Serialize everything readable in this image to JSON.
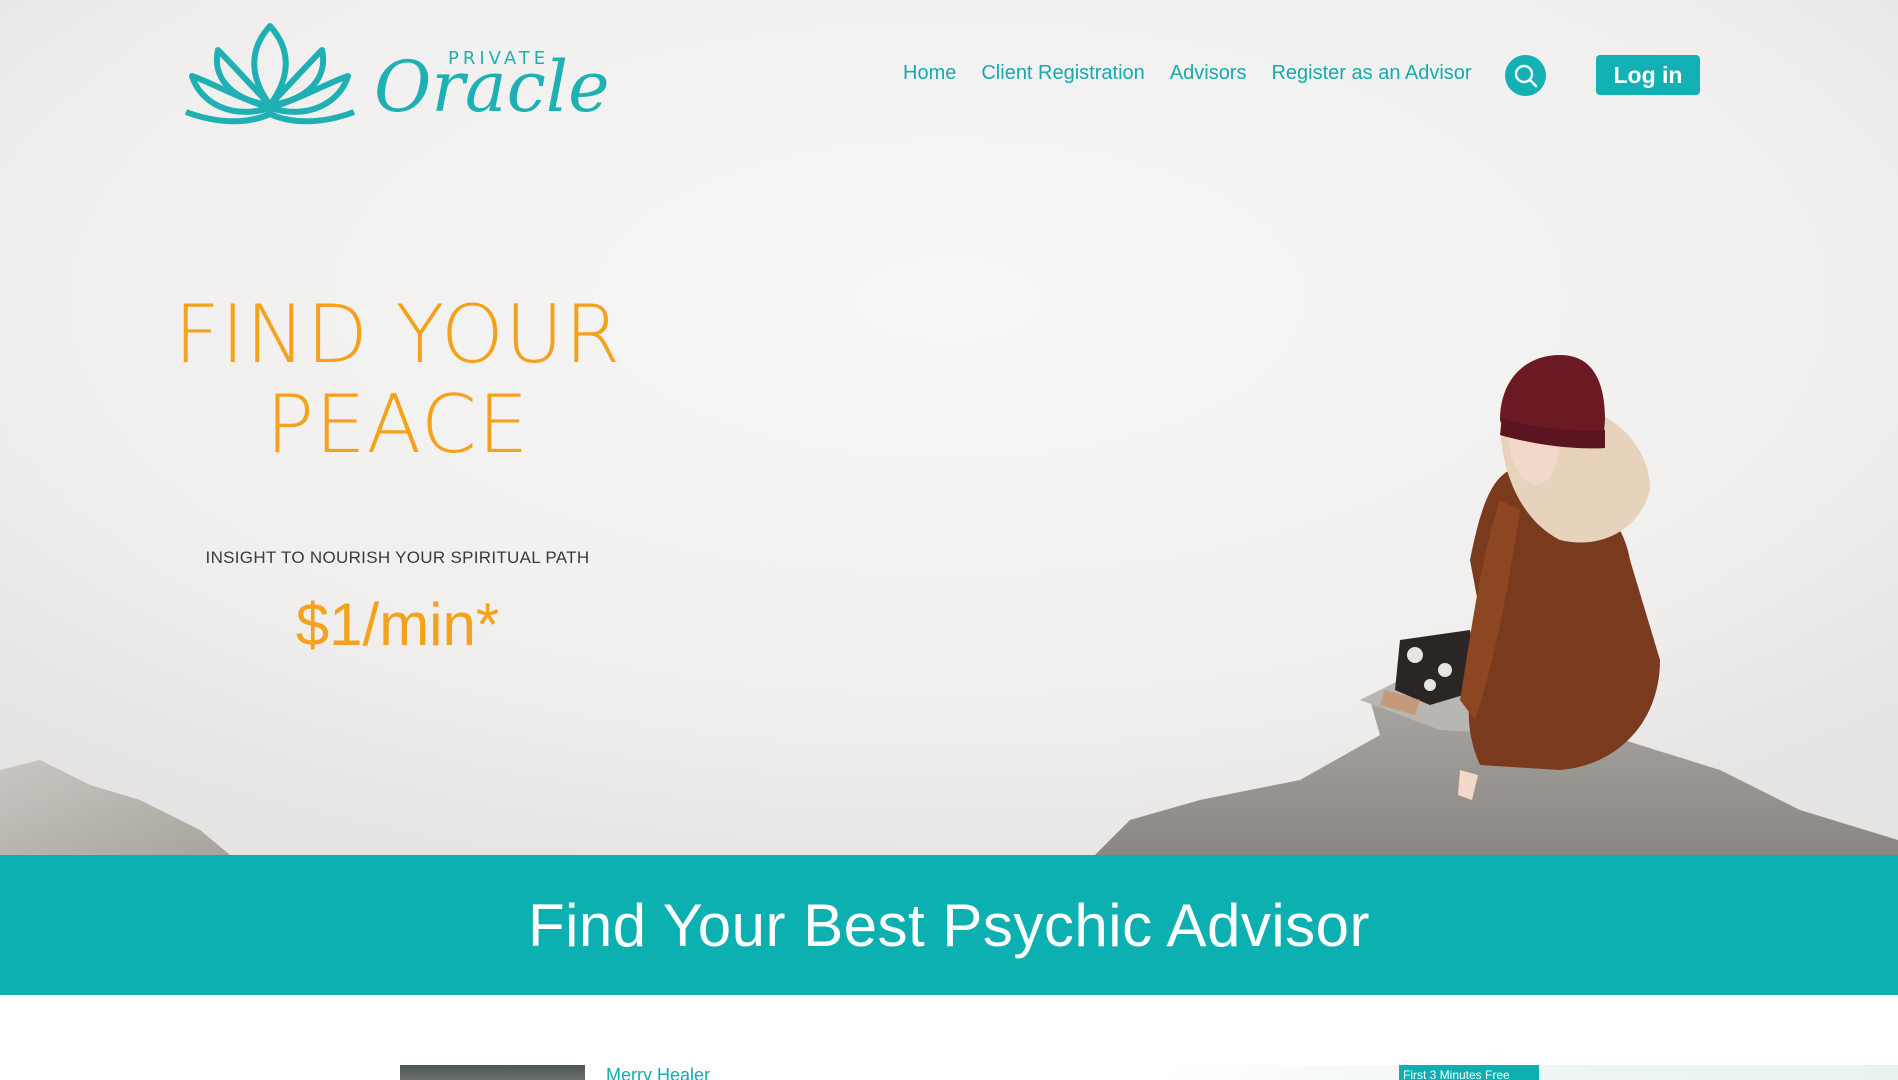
{
  "header": {
    "logo": {
      "small_text": "PRIVATE",
      "script_text": "Oracle"
    },
    "nav": [
      {
        "label": "Home"
      },
      {
        "label": "Client Registration"
      },
      {
        "label": "Advisors"
      },
      {
        "label": "Register as an Advisor"
      }
    ],
    "search_icon": "search-icon",
    "login_label": "Log in"
  },
  "hero": {
    "title_line1": "FIND YOUR",
    "title_line2": "PEACE",
    "subtitle": "INSIGHT TO NOURISH YOUR SPIRITUAL PATH",
    "price": "$1/min*"
  },
  "banner": {
    "title": "Find Your Best Psychic Advisor"
  },
  "advisors": {
    "first_name": "Merry Healer",
    "promo_badge": "First 3 Minutes Free"
  },
  "colors": {
    "teal": "#0db0b1",
    "orange": "#f4a11b",
    "nav_text": "#17a9ad"
  }
}
